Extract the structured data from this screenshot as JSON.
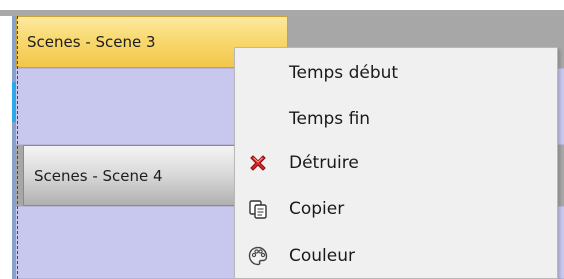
{
  "timeline": {
    "clips": [
      {
        "label": "Scenes - Scene 3",
        "state": "selected"
      },
      {
        "label": "Scenes - Scene 4",
        "state": "normal"
      }
    ]
  },
  "context_menu": {
    "items": [
      {
        "label": "Temps début",
        "icon": "none"
      },
      {
        "label": "Temps fin",
        "icon": "none"
      },
      {
        "label": "Détruire",
        "icon": "red-x-icon"
      },
      {
        "label": "Copier",
        "icon": "copy-icon"
      },
      {
        "label": "Couleur",
        "icon": "palette-icon"
      }
    ]
  },
  "colors": {
    "selected_clip": "#f6d266",
    "clip": "#d0d0d0",
    "lane": "#c8c8ee",
    "cursor": "#2a33e8",
    "menu_background": "#f0f0f0",
    "delete_icon": "#e02a2a"
  }
}
